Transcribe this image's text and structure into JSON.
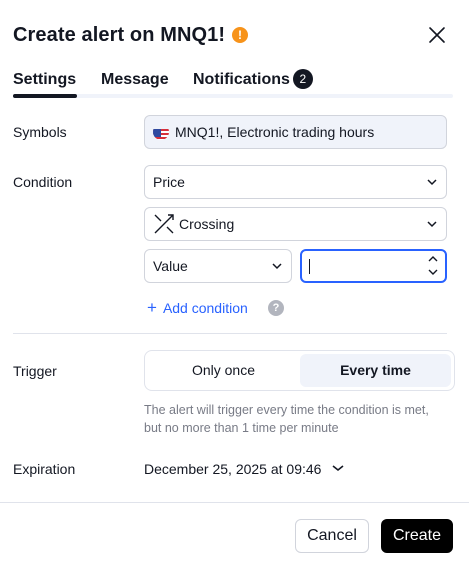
{
  "header": {
    "title": "Create alert on MNQ1!",
    "warning_glyph": "!"
  },
  "tabs": [
    {
      "label": "Settings",
      "active": true
    },
    {
      "label": "Message",
      "active": false
    },
    {
      "label": "Notifications",
      "active": false,
      "badge": "2"
    }
  ],
  "symbols": {
    "label": "Symbols",
    "value": "MNQ1!, Electronic trading hours",
    "flag_icon": "us-flag-icon"
  },
  "condition": {
    "label": "Condition",
    "source": "Price",
    "operator": "Crossing",
    "operand_type": "Value",
    "operand_value": "",
    "add_label": "Add condition",
    "help_glyph": "?"
  },
  "trigger": {
    "label": "Trigger",
    "options": [
      "Only once",
      "Every time"
    ],
    "selected": "Every time",
    "hint": "The alert will trigger every time the condition is met, but no more than 1 time per minute"
  },
  "expiration": {
    "label": "Expiration",
    "value": "December 25, 2025 at 09:46"
  },
  "footer": {
    "cancel_label": "Cancel",
    "create_label": "Create"
  },
  "colors": {
    "accent": "#2962ff",
    "warning": "#f7931a",
    "primary_button": "#000000"
  }
}
